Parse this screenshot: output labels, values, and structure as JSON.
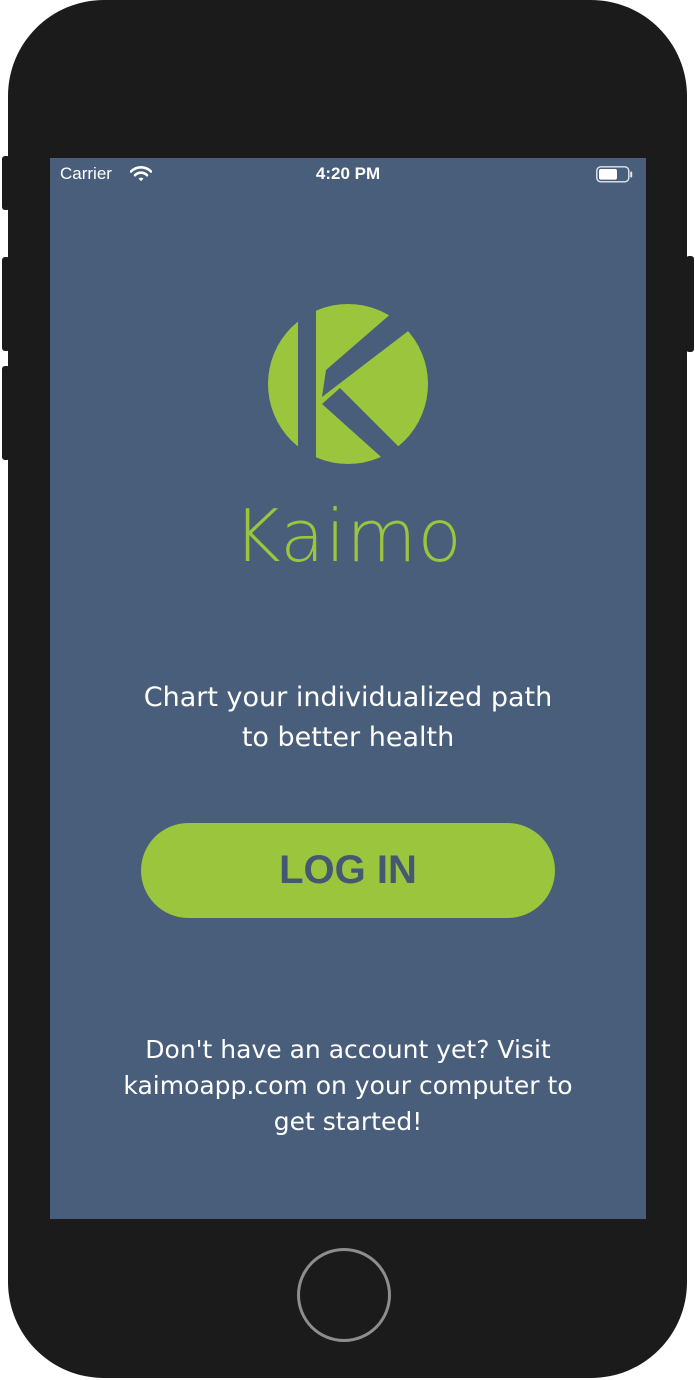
{
  "status_bar": {
    "carrier": "Carrier",
    "time": "4:20 PM",
    "wifi_icon": "wifi-icon",
    "battery_icon": "battery-icon"
  },
  "brand": {
    "logo_icon": "kaimo-k-logo",
    "name": "Kaimo",
    "accent_color": "#9bc53d",
    "background_color": "#495e7b"
  },
  "tagline": {
    "line1": "Chart your individualized path",
    "line2": "to better health"
  },
  "login_button": {
    "label": "LOG IN",
    "text_color": "#445873"
  },
  "signup_note": {
    "line1": "Don't have an account yet? Visit",
    "line2": "kaimoapp.com on your computer to",
    "line3": "get started!"
  }
}
